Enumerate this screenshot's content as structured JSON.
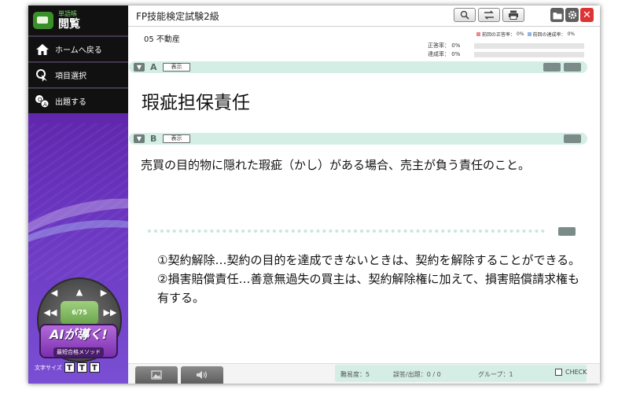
{
  "sidebar": {
    "logo_sub": "単語帳",
    "logo_main": "閲覧",
    "nav": [
      {
        "label": "ホームへ戻る",
        "icon": "home-icon"
      },
      {
        "label": "項目選択",
        "icon": "pointer-icon"
      },
      {
        "label": "出題する",
        "icon": "qa-icon"
      }
    ],
    "progress": "6/75",
    "ai_badge": {
      "title": "AIが導く!",
      "subtitle": "最短合格メソッド"
    },
    "font_size_label": "文字サイズ",
    "font_size_buttons": [
      "T",
      "T",
      "T"
    ]
  },
  "header": {
    "title": "FP技能検定試験2級",
    "section": "05 不動産",
    "legend_prev_correct": "前回の正答率：",
    "legend_prev_correct_value": "0%",
    "legend_prev_achieve": "前回の達成率：",
    "legend_prev_achieve_value": "0%",
    "correct_rate_label": "正答率：",
    "correct_rate_value": "0%",
    "achieve_rate_label": "達成率：",
    "achieve_rate_value": "0%",
    "correct_rate": 0,
    "achieve_rate": 0,
    "colors": {
      "prev_correct": "#e88a8a",
      "prev_achieve": "#8fb7e0"
    }
  },
  "card": {
    "a_letter": "A",
    "b_letter": "B",
    "show_label": "表示",
    "term": "瑕疵担保責任",
    "definition": "売買の目的物に隠れた瑕疵（かし）がある場合、売主が負う責任のこと。",
    "answer_lines": [
      "①契約解除…契約の目的を達成できないときは、契約を解除することができる。",
      "②損害賠償責任…善意無過失の買主は、契約解除権に加えて、損害賠償請求権も有する。"
    ]
  },
  "footer": {
    "difficulty": "難易度：5",
    "wrong": "誤答/出題：0 / 0",
    "group": "グループ：1",
    "check": "CHECK"
  },
  "colors": {
    "accent_band": "#d4eee6",
    "sidebar": "#5d22a6",
    "close": "#dd3333"
  }
}
